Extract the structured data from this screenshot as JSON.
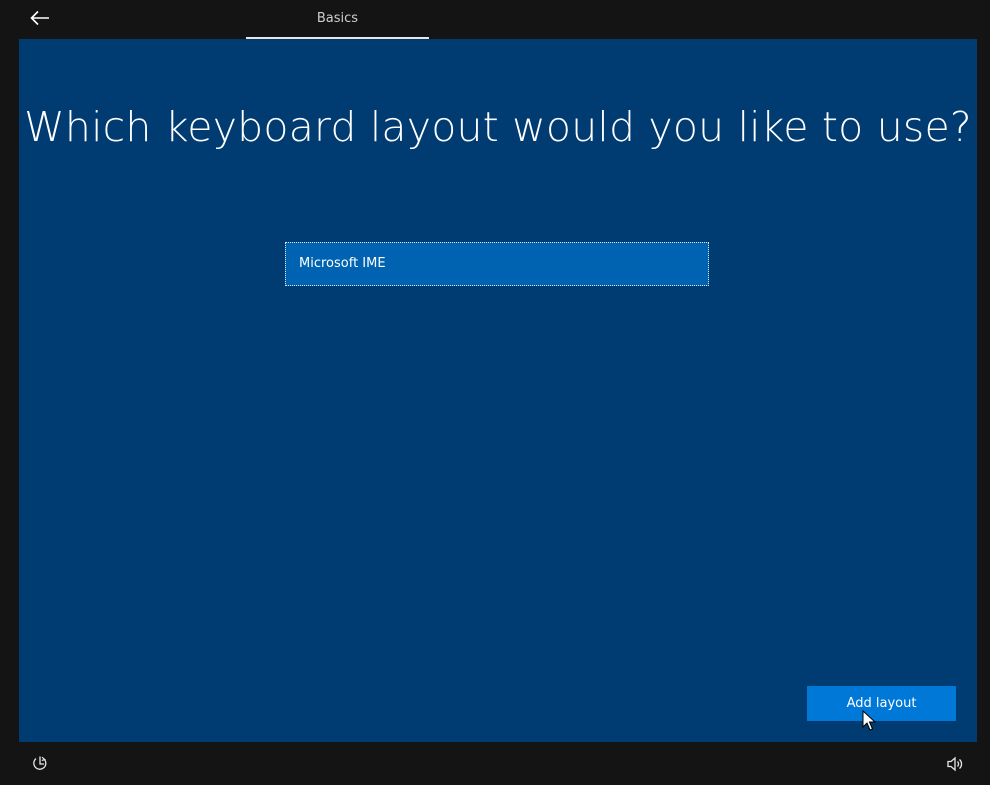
{
  "header": {
    "back_icon": "arrow-left-icon",
    "tab_label": "Basics"
  },
  "main": {
    "title": "Which keyboard layout would you like to use?",
    "layouts": [
      {
        "label": "Microsoft IME",
        "selected": true
      }
    ],
    "add_button_label": "Add layout"
  },
  "footer": {
    "left_icon": "ease-of-access-icon",
    "right_icon": "volume-icon"
  },
  "colors": {
    "chrome": "#141414",
    "panel": "#003b71",
    "selected_item": "#0063b1",
    "accent_button": "#0078d7",
    "text": "#ffffff"
  }
}
